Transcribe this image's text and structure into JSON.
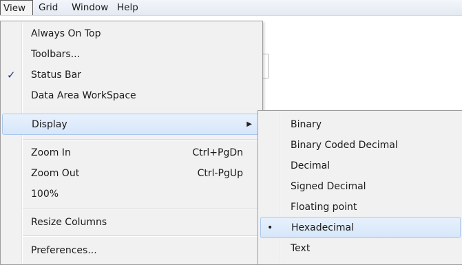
{
  "menubar": {
    "items": [
      "View",
      "Grid",
      "Window",
      "Help"
    ]
  },
  "view_menu": {
    "items": [
      {
        "label": "Always On Top"
      },
      {
        "label": "Toolbars..."
      },
      {
        "label": "Status Bar",
        "checked": true
      },
      {
        "label": "Data Area WorkSpace"
      },
      {
        "label": "Display",
        "submenu": true,
        "highlighted": true
      },
      {
        "label": "Zoom In",
        "shortcut": "Ctrl+PgDn"
      },
      {
        "label": "Zoom Out",
        "shortcut": "Ctrl-PgUp"
      },
      {
        "label": "100%"
      },
      {
        "label": "Resize Columns"
      },
      {
        "label": "Preferences..."
      }
    ],
    "check_glyph": "✓",
    "arrow_glyph": "▶"
  },
  "display_submenu": {
    "items": [
      {
        "label": "Binary"
      },
      {
        "label": "Binary Coded Decimal"
      },
      {
        "label": "Decimal"
      },
      {
        "label": "Signed Decimal"
      },
      {
        "label": "Floating point"
      },
      {
        "label": "Hexadecimal",
        "selected": true,
        "highlighted": true
      },
      {
        "label": "Text"
      }
    ],
    "bullet_glyph": "•"
  },
  "colors": {
    "highlight": "#d6e6fa",
    "highlight_border": "#a9c7ee",
    "check": "#1d3c82"
  }
}
